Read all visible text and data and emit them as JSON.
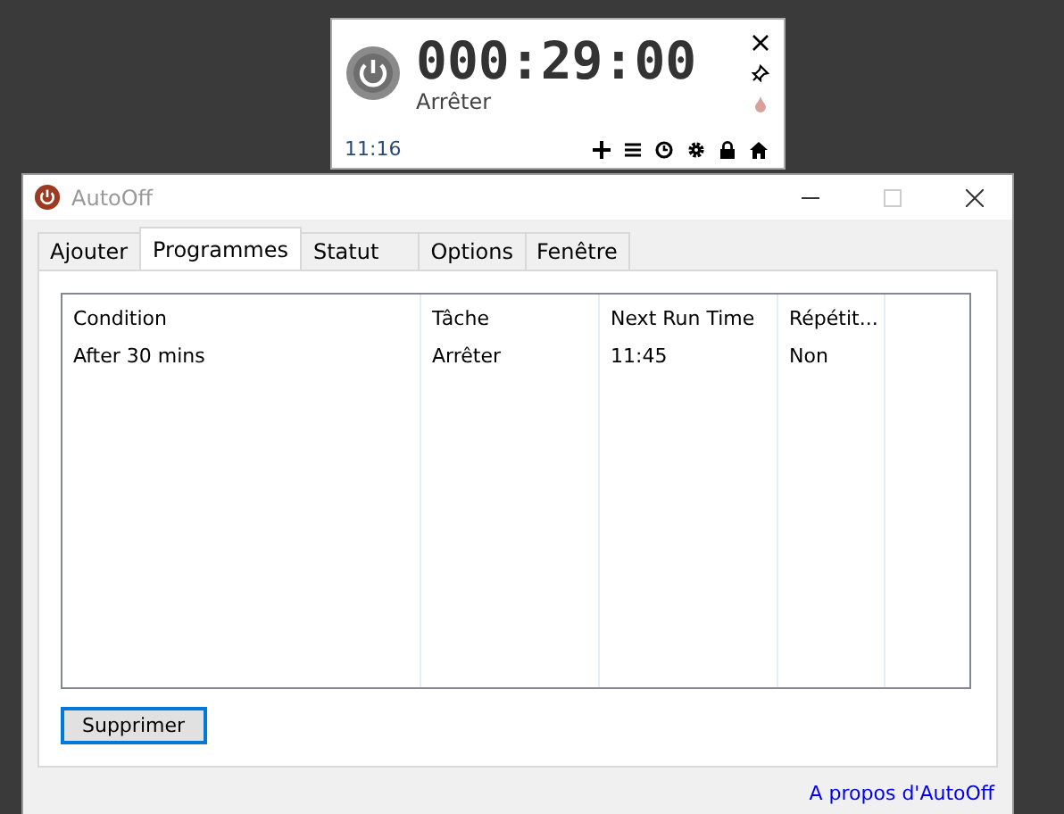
{
  "timer_widget": {
    "countdown": "000:29:00",
    "task": "Arrêter",
    "clock": "11:16"
  },
  "window": {
    "title": "AutoOff"
  },
  "tabs": [
    {
      "label": "Ajouter",
      "selected": false
    },
    {
      "label": "Programmes",
      "selected": true
    },
    {
      "label": "Statut",
      "selected": false
    },
    {
      "label": "Options",
      "selected": false
    },
    {
      "label": "Fenêtre",
      "selected": false
    }
  ],
  "table": {
    "columns": [
      "Condition",
      "Tâche",
      "Next Run Time",
      "Répétit..."
    ],
    "rows": [
      [
        "After 30 mins",
        "Arrêter",
        "11:45",
        "Non"
      ]
    ]
  },
  "buttons": [
    "Supprimer"
  ],
  "status_bar": {
    "link": "A propos d'AutoOff"
  }
}
